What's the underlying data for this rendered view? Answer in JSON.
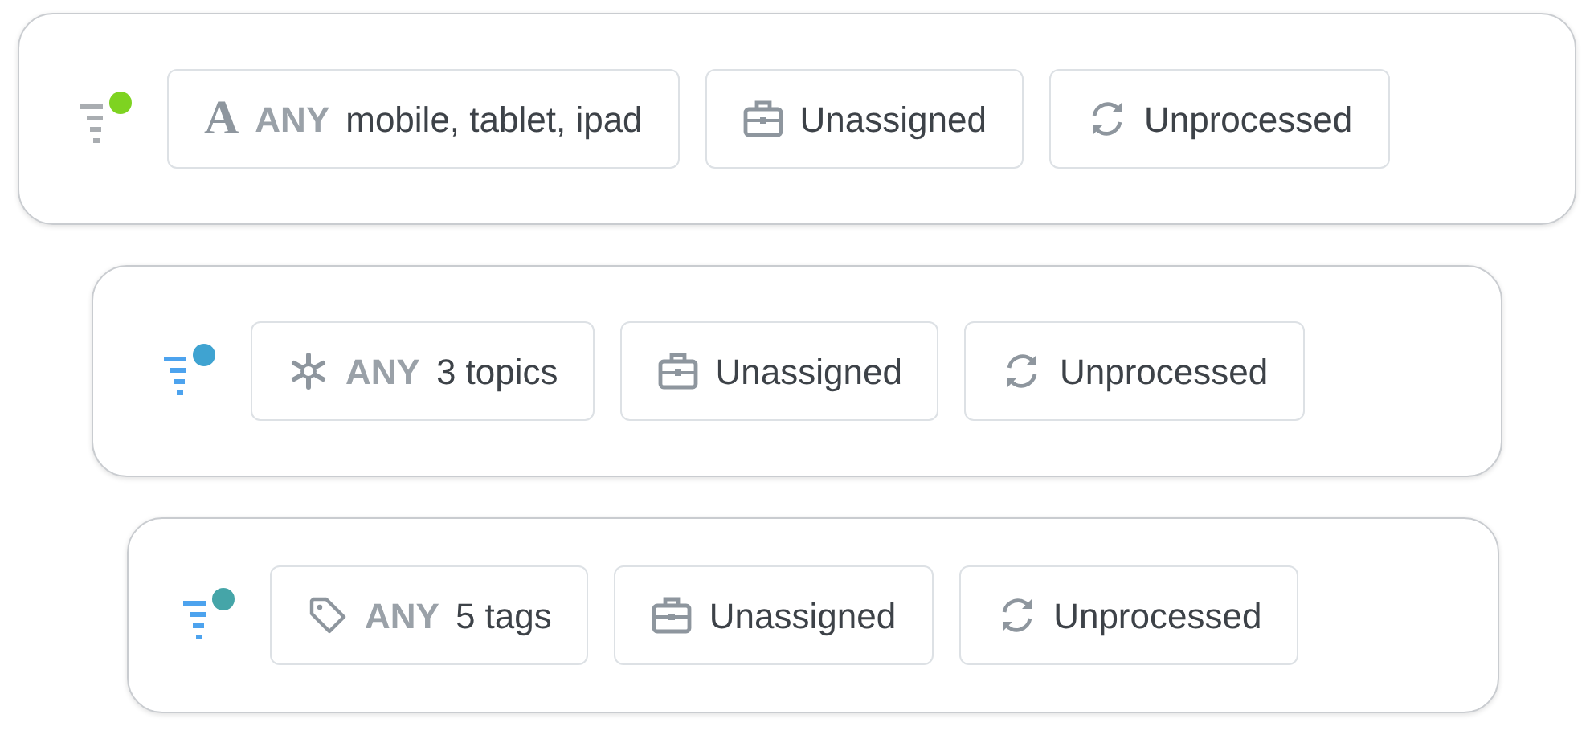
{
  "rules": [
    {
      "filter_active": false,
      "color": "#7ed321",
      "chips": [
        {
          "kind": "device",
          "glyph": "A",
          "qualifier": "ANY",
          "value": "mobile, tablet, ipad"
        },
        {
          "kind": "assignee",
          "value": "Unassigned"
        },
        {
          "kind": "status",
          "value": "Unprocessed"
        }
      ]
    },
    {
      "filter_active": true,
      "color": "#3fa3d1",
      "chips": [
        {
          "kind": "topics",
          "qualifier": "ANY",
          "value": "3 topics"
        },
        {
          "kind": "assignee",
          "value": "Unassigned"
        },
        {
          "kind": "status",
          "value": "Unprocessed"
        }
      ]
    },
    {
      "filter_active": true,
      "color": "#45a5a8",
      "chips": [
        {
          "kind": "tags",
          "qualifier": "ANY",
          "value": "5 tags"
        },
        {
          "kind": "assignee",
          "value": "Unassigned"
        },
        {
          "kind": "status",
          "value": "Unprocessed"
        }
      ]
    }
  ]
}
